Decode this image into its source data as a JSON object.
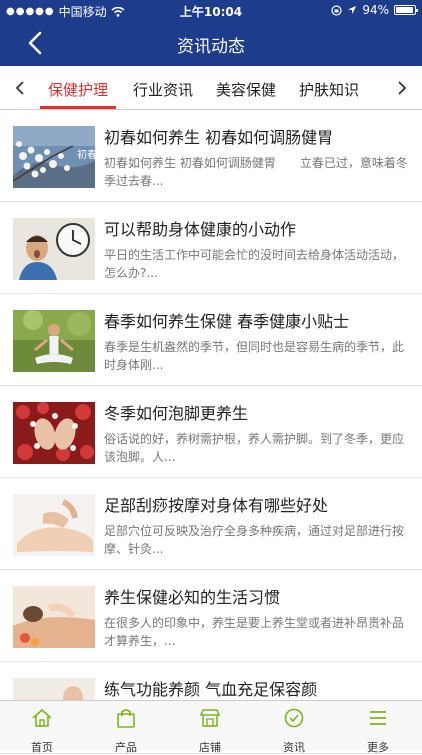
{
  "status_bar": {
    "carrier": "中国移动",
    "time": "上午10:04",
    "battery": "94%"
  },
  "nav": {
    "title": "资讯动态"
  },
  "tabs": [
    {
      "label": "保健护理",
      "active": true
    },
    {
      "label": "行业资讯",
      "active": false
    },
    {
      "label": "美容保健",
      "active": false
    },
    {
      "label": "护肤知识",
      "active": false
    }
  ],
  "articles": [
    {
      "title": "初春如何养生 初春如何调肠健胃",
      "summary": "初春如何养生 初春如何调肠健胃　　立春已过，意味着冬季过去春..."
    },
    {
      "title": "可以帮助身体健康的小动作",
      "summary": "平日的生活工作中可能会忙的没时间去给身体活动活动，怎么办?..."
    },
    {
      "title": "春季如何养生保健 春季健康小贴士",
      "summary": "春季是生机盎然的季节，但同时也是容易生病的季节，此时身体刚..."
    },
    {
      "title": "冬季如何泡脚更养生",
      "summary": "俗话说的好，养树需护根，养人需护脚。到了冬季，更应该泡脚。人..."
    },
    {
      "title": "足部刮痧按摩对身体有哪些好处",
      "summary": "足部穴位可反映及治疗全身多种疾病，通过对足部进行按摩、针灸..."
    },
    {
      "title": "养生保健必知的生活习惯",
      "summary": "在很多人的印象中，养生是要上养生堂或者进补昂贵补品才算养生，..."
    },
    {
      "title": "练气功能养颜 气血充足保容颜",
      "summary": ""
    }
  ],
  "thumb_text": "初春",
  "tab_bar": [
    {
      "label": "首页",
      "icon": "home-icon",
      "color": "#7cb518"
    },
    {
      "label": "产品",
      "icon": "shopping-bag-icon",
      "color": "#7cb518"
    },
    {
      "label": "店铺",
      "icon": "store-icon",
      "color": "#7cb518"
    },
    {
      "label": "资讯",
      "icon": "news-icon",
      "color": "#7cb518"
    },
    {
      "label": "更多",
      "icon": "more-list-icon",
      "color": "#7cb518"
    }
  ],
  "colors": {
    "header": "#1e3c8c",
    "active_tab": "#e03030",
    "tabbar_icon": "#7cb518"
  }
}
